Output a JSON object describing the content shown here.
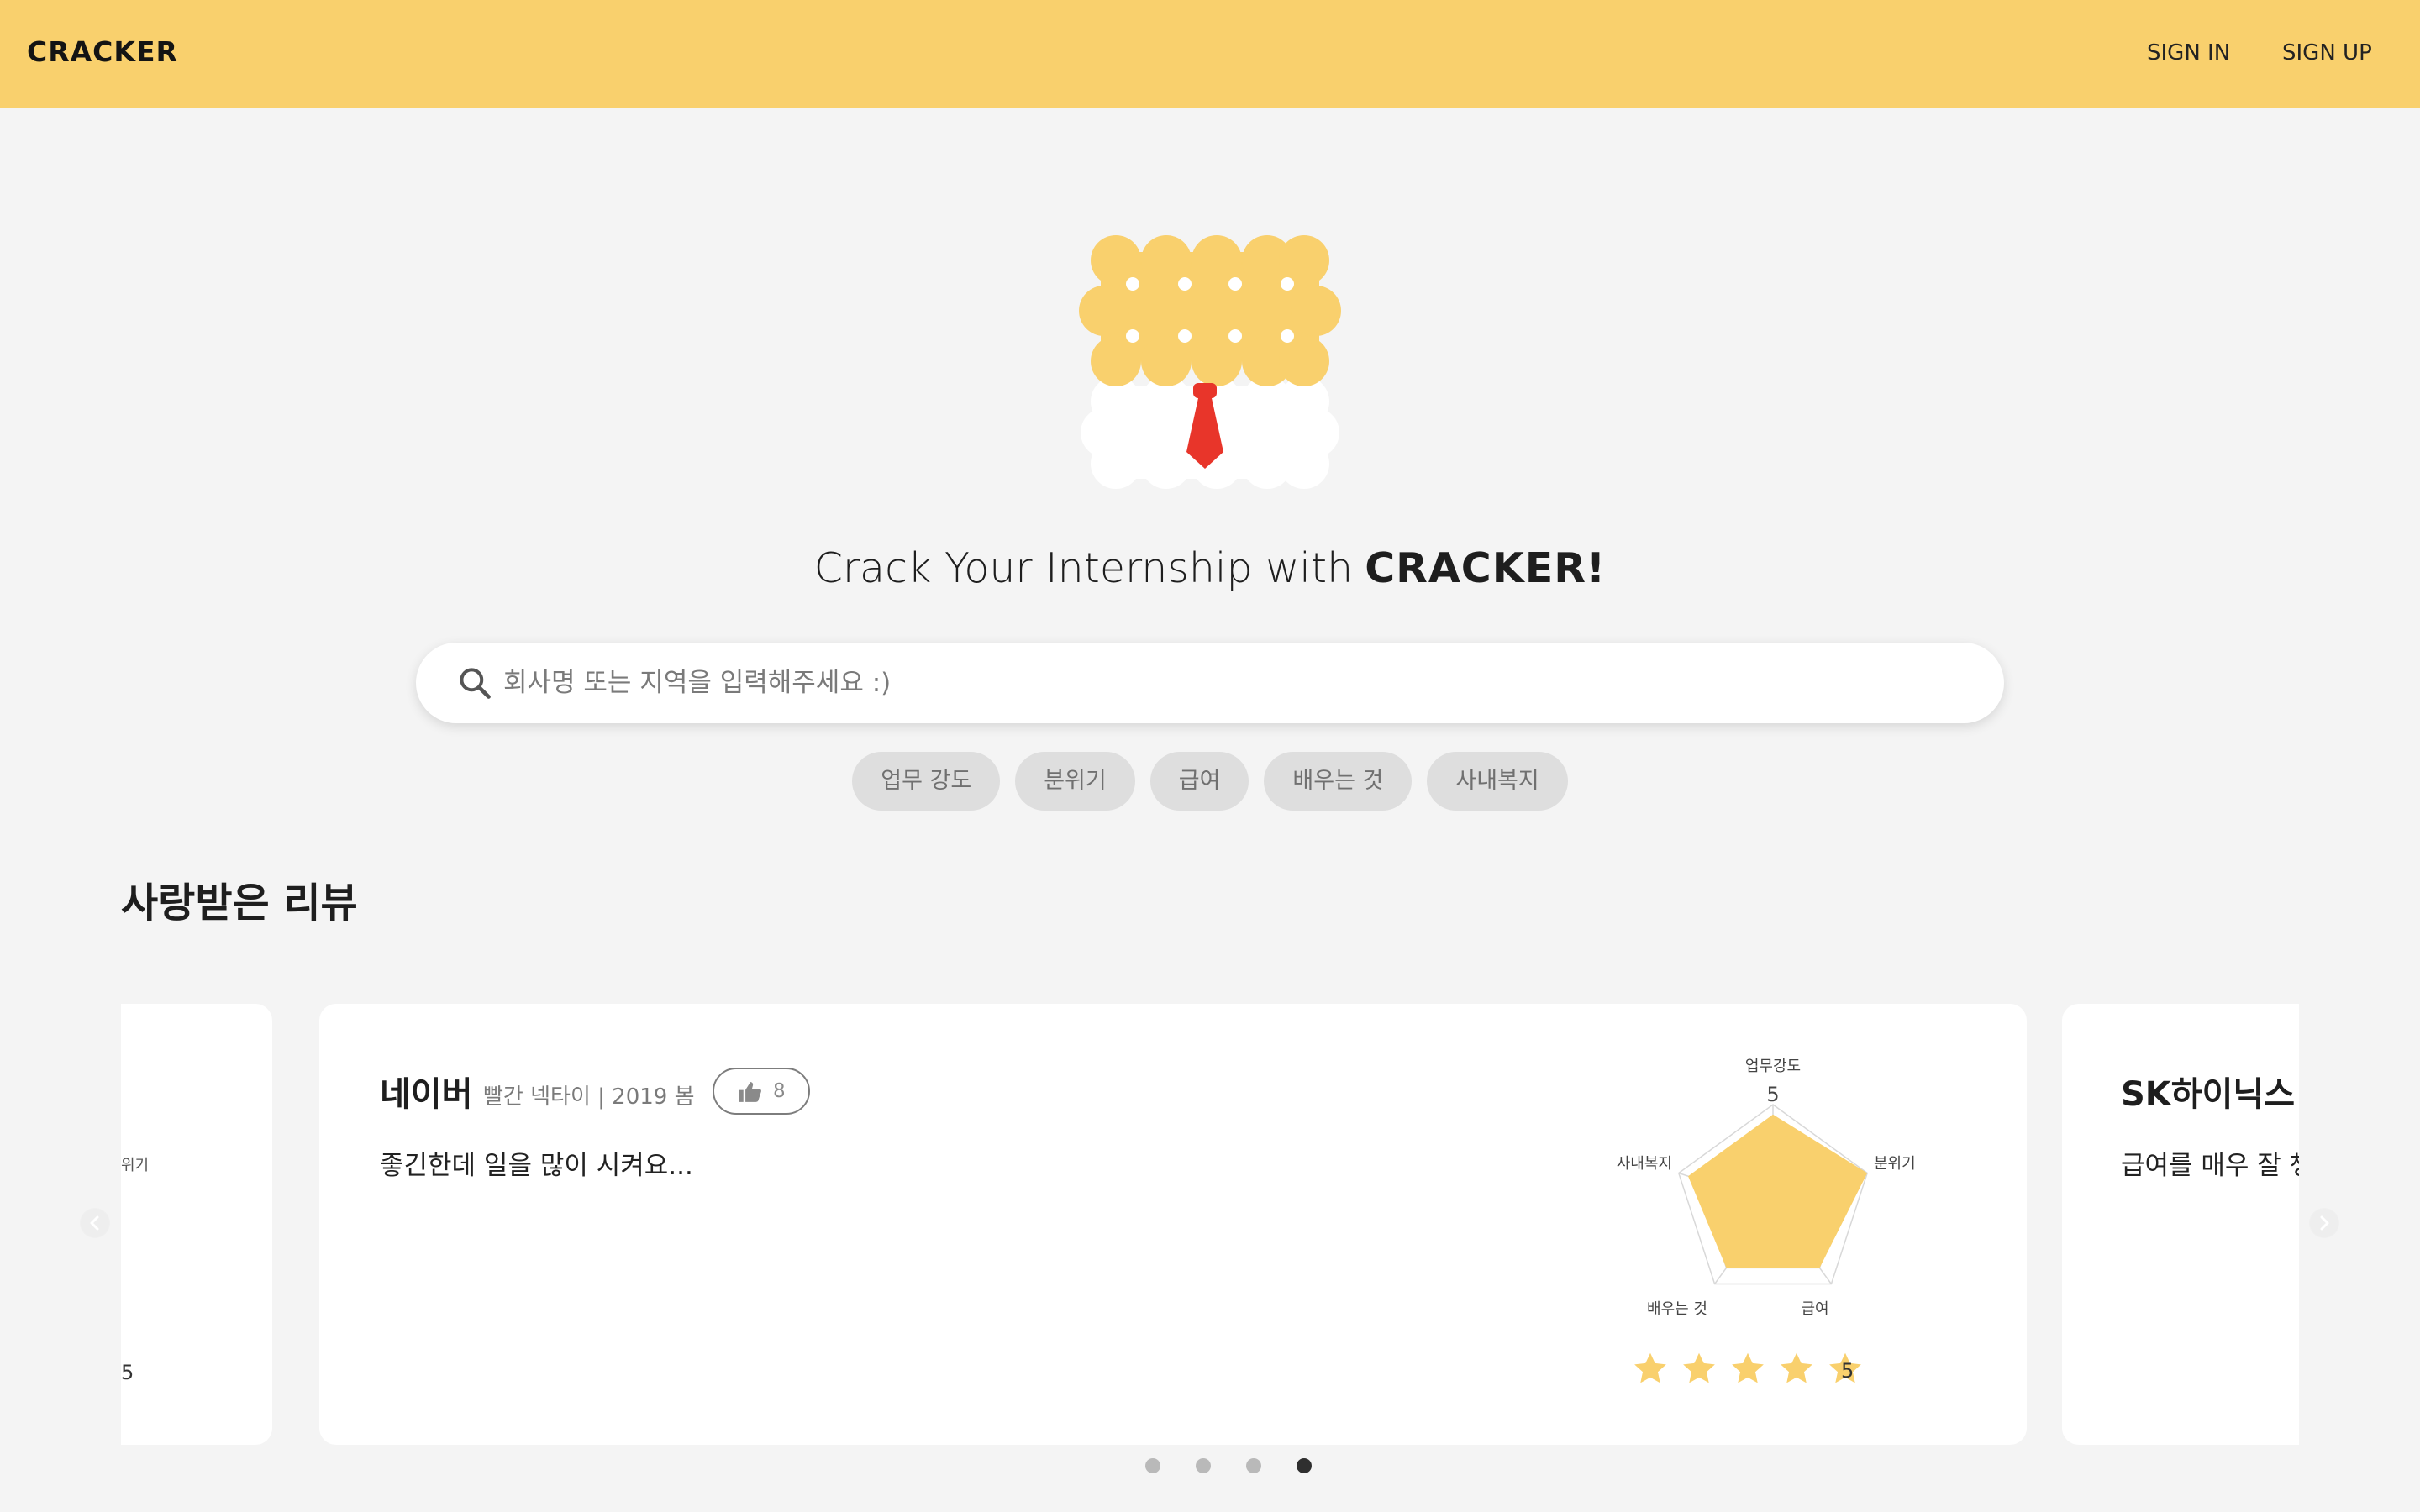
{
  "header": {
    "brand": "CRACKER",
    "sign_in": "SIGN IN",
    "sign_up": "SIGN UP",
    "background_color": "#f9d06d"
  },
  "hero": {
    "tagline": "Crack Your  Internship with",
    "tagline_brand": "CRACKER!",
    "logo_icon": "cracker-with-tie-logo"
  },
  "search": {
    "placeholder": "회사명 또는 지역을 입력해주세요 :)",
    "icon": "search-icon"
  },
  "chips": [
    "업무 강도",
    "분위기",
    "급여",
    "배우는 것",
    "사내복지"
  ],
  "section": {
    "title": "사랑받은 리뷰"
  },
  "carousel": {
    "left_card": {
      "radar_label_partial": "위기",
      "score": "5"
    },
    "main_card": {
      "company": "네이버",
      "meta": "빨간 넥타이 | 2019 봄",
      "likes": "8",
      "review": "좋긴한데 일을 많이 시켜요...",
      "radar": {
        "axes": [
          "업무강도",
          "분위기",
          "급여",
          "배우는 것",
          "사내복지"
        ],
        "scale_label": "5",
        "values": [
          4.5,
          5,
          4,
          4,
          4.5
        ],
        "max": 5,
        "fill_color": "#f9d06d"
      },
      "stars": 5,
      "score": "5",
      "star_color": "#f9d06d"
    },
    "right_card": {
      "company": "SK하이닉스",
      "review": "급여를 매우 잘 챙"
    },
    "pagination": {
      "count": 4,
      "active_index": 3
    }
  }
}
